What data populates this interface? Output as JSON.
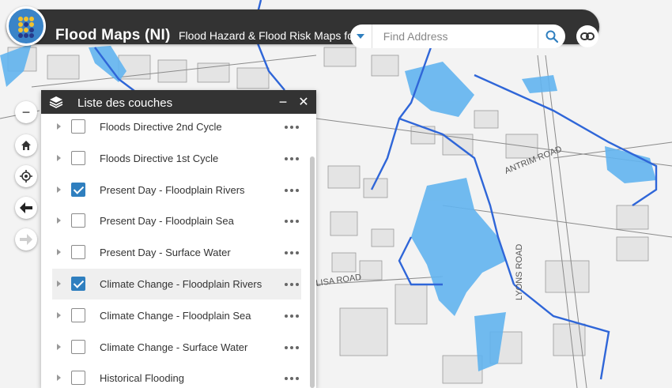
{
  "header": {
    "app_title": "Flood Maps (NI)",
    "app_subtitle": "Flood Hazard & Flood Risk Maps for NI",
    "search_placeholder": "Find Address",
    "logo_icon": "dfi-logo-icon",
    "share_icon": "link-icon",
    "search_icon": "search-icon",
    "dropdown_icon": "caret-down-icon"
  },
  "map_controls": [
    {
      "icon": "zoom-out-icon",
      "glyph": "−"
    },
    {
      "icon": "home-icon"
    },
    {
      "icon": "locate-icon"
    },
    {
      "icon": "back-arrow-icon"
    },
    {
      "icon": "forward-arrow-icon"
    }
  ],
  "map_labels": {
    "road_1": "ANTRIM ROAD",
    "road_2": "LISA ROAD",
    "road_3": "LYONS ROAD"
  },
  "layer_panel": {
    "title": "Liste des couches",
    "minimize_glyph": "−",
    "close_glyph": "✕",
    "layers": [
      {
        "label": "Floods Directive 2nd Cycle",
        "checked": false,
        "selected": false
      },
      {
        "label": "Floods Directive 1st Cycle",
        "checked": false,
        "selected": false
      },
      {
        "label": "Present Day - Floodplain Rivers",
        "checked": true,
        "selected": false
      },
      {
        "label": "Present Day - Floodplain Sea",
        "checked": false,
        "selected": false
      },
      {
        "label": "Present Day - Surface Water",
        "checked": false,
        "selected": false
      },
      {
        "label": "Climate Change - Floodplain Rivers",
        "checked": true,
        "selected": true
      },
      {
        "label": "Climate Change - Floodplain Sea",
        "checked": false,
        "selected": false
      },
      {
        "label": "Climate Change - Surface Water",
        "checked": false,
        "selected": false
      },
      {
        "label": "Historical Flooding",
        "checked": false,
        "selected": false
      }
    ]
  },
  "colors": {
    "header_bg": "#333333",
    "accent": "#2f7fbf",
    "flood_fill": "#62b4ef",
    "river_line": "#2f66d8"
  }
}
